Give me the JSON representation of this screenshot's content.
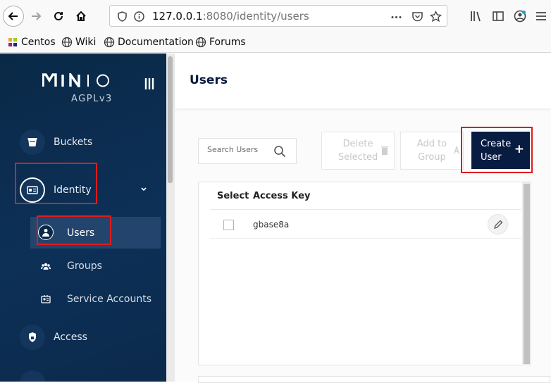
{
  "browser": {
    "url_host": "127.0.0.1",
    "url_rest": ":8080/identity/users",
    "bookmarks": [
      {
        "label": "Centos",
        "icon": "centos-icon"
      },
      {
        "label": "Wiki",
        "icon": "globe-icon"
      },
      {
        "label": "Documentation",
        "icon": "globe-icon"
      },
      {
        "label": "Forums",
        "icon": "globe-icon"
      }
    ]
  },
  "sidebar": {
    "logo": "MINIO",
    "license": "AGPLv3",
    "items": {
      "buckets": {
        "label": "Buckets",
        "icon": "bucket-icon"
      },
      "identity": {
        "label": "Identity",
        "icon": "id-card-icon"
      },
      "users": {
        "label": "Users",
        "icon": "user-icon"
      },
      "groups": {
        "label": "Groups",
        "icon": "groups-icon"
      },
      "service_accounts": {
        "label": "Service Accounts",
        "icon": "service-account-icon"
      },
      "access": {
        "label": "Access",
        "icon": "lock-icon"
      }
    }
  },
  "main": {
    "title": "Users",
    "search_placeholder": "Search Users",
    "buttons": {
      "delete_line1": "Delete",
      "delete_line2": "Selected",
      "add_line1": "Add to",
      "add_line2": "Group",
      "create_line1": "Create",
      "create_line2": "User",
      "create_plus": "+"
    },
    "table": {
      "columns": [
        "Select",
        "Access Key"
      ],
      "rows": [
        {
          "access_key": "gbase8a"
        }
      ]
    }
  },
  "colors": {
    "sidebar_bg": "#0d3057",
    "primary": "#081c42",
    "annotation": "#e01b1b"
  }
}
